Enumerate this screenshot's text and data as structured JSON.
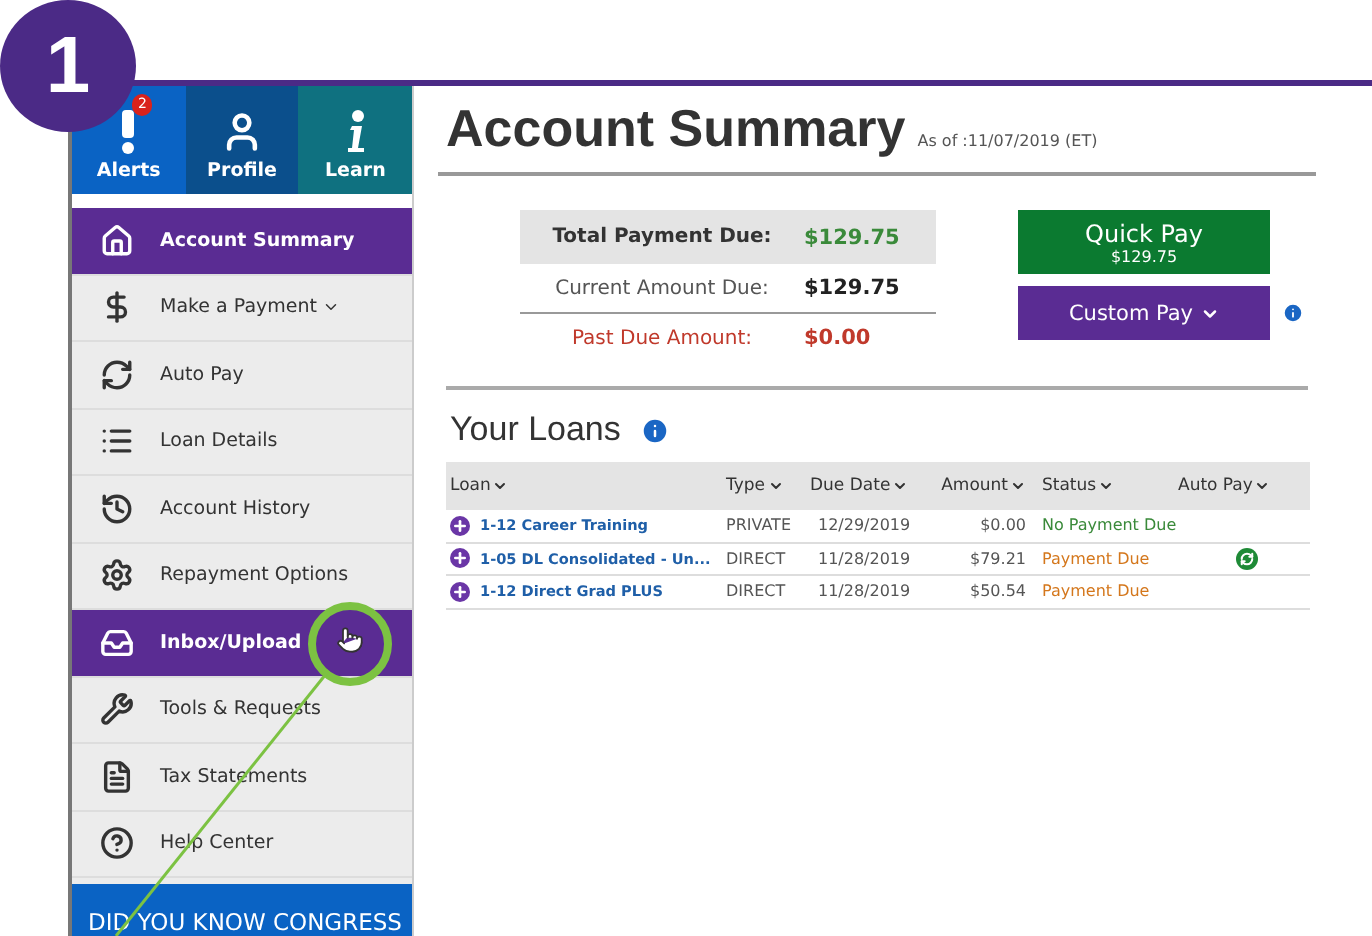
{
  "step_badge": "1",
  "top_tiles": [
    {
      "kind": "alerts",
      "label": "Alerts",
      "badge": "2"
    },
    {
      "kind": "profile",
      "label": "Profile"
    },
    {
      "kind": "learn",
      "label": "Learn"
    }
  ],
  "sidebar": {
    "items": [
      {
        "label": "Account Summary",
        "highlighted": true
      },
      {
        "label": "Make a Payment",
        "highlighted": false,
        "has_menu": true
      },
      {
        "label": "Auto Pay",
        "highlighted": false
      },
      {
        "label": "Loan Details",
        "highlighted": false
      },
      {
        "label": "Account History",
        "highlighted": false
      },
      {
        "label": "Repayment Options",
        "highlighted": false
      },
      {
        "label": "Inbox/Upload",
        "highlighted": true,
        "pointer": true
      },
      {
        "label": "Tools & Requests",
        "highlighted": false
      },
      {
        "label": "Tax Statements",
        "highlighted": false
      },
      {
        "label": "Help Center",
        "highlighted": false
      }
    ],
    "banner": "DID YOU KNOW CONGRESS"
  },
  "header": {
    "title": "Account Summary",
    "as_of": "As of :11/07/2019 (ET)"
  },
  "summary": [
    {
      "kind": "total",
      "label": "Total Payment Due:",
      "value": "$129.75"
    },
    {
      "kind": "current",
      "label": "Current Amount Due:",
      "value": "$129.75"
    },
    {
      "kind": "past_due",
      "label": "Past Due Amount:",
      "value": "$0.00"
    }
  ],
  "quick_pay": {
    "label": "Quick Pay",
    "amount": "$129.75"
  },
  "custom_pay": {
    "label": "Custom Pay"
  },
  "loans": {
    "title": "Your Loans",
    "columns": [
      "Loan",
      "Type",
      "Due Date",
      "Amount",
      "Status",
      "Auto Pay"
    ],
    "rows": [
      {
        "loan": "1-12 Career Training",
        "type": "PRIVATE",
        "due_date": "12/29/2019",
        "amount": "$0.00",
        "status": "No Payment Due",
        "color": "#3a8a3a",
        "auto_pay": false
      },
      {
        "loan": "1-05 DL Consolidated - Un...",
        "type": "DIRECT",
        "due_date": "11/28/2019",
        "amount": "$79.21",
        "status": "Payment Due",
        "color": "#d4771c",
        "auto_pay": true
      },
      {
        "loan": "1-12 Direct Grad PLUS",
        "type": "DIRECT",
        "due_date": "11/28/2019",
        "amount": "$50.54",
        "status": "Payment Due",
        "color": "#d4771c",
        "auto_pay": false
      }
    ]
  }
}
